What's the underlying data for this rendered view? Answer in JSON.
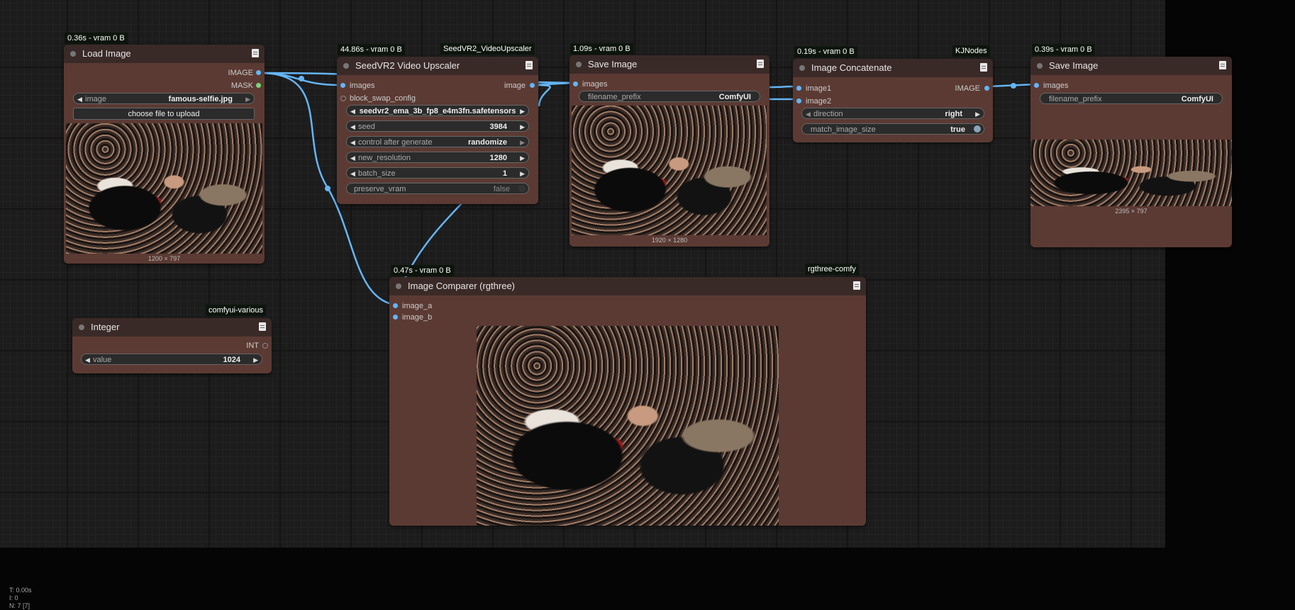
{
  "colors": {
    "canvas": "#1c1c1c",
    "node_body": "#5b3a33",
    "node_title": "#3a2a27",
    "link": "#64b5f6",
    "badge": "#0d150d"
  },
  "nodes": {
    "load_image": {
      "badge": "0.36s - vram 0 B",
      "title": "Load Image",
      "outputs": [
        "IMAGE",
        "MASK"
      ],
      "image_widget": {
        "label": "image",
        "value": "famous-selfie.jpg"
      },
      "upload_button": "choose file to upload",
      "size": "1200 × 797"
    },
    "seedvr2": {
      "badge": "44.86s - vram 0 B",
      "source": "SeedVR2_VideoUpscaler",
      "title": "SeedVR2 Video Upscaler",
      "inputs": [
        "images",
        "block_swap_config"
      ],
      "output": "image",
      "widgets": [
        {
          "label": "",
          "value": "seedvr2_ema_3b_fp8_e4m3fn.safetensors"
        },
        {
          "label": "seed",
          "value": "3984"
        },
        {
          "label": "control after generate",
          "value": "randomize"
        },
        {
          "label": "new_resolution",
          "value": "1280"
        },
        {
          "label": "batch_size",
          "value": "1"
        },
        {
          "label": "preserve_vram",
          "value": "false"
        }
      ]
    },
    "save_image_1": {
      "badge": "1.09s - vram 0 B",
      "title": "Save Image",
      "input": "images",
      "prefix_label": "filename_prefix",
      "prefix_value": "ComfyUI",
      "size": "1920 × 1280"
    },
    "concat": {
      "badge": "0.19s - vram 0 B",
      "source": "KJNodes",
      "title": "Image Concatenate",
      "inputs": [
        "image1",
        "image2"
      ],
      "output": "IMAGE",
      "widgets": [
        {
          "label": "direction",
          "value": "right"
        },
        {
          "label": "match_image_size",
          "value": "true"
        }
      ]
    },
    "save_image_2": {
      "badge": "0.39s - vram 0 B",
      "title": "Save Image",
      "input": "images",
      "prefix_label": "filename_prefix",
      "prefix_value": "ComfyUI",
      "size": "2395 × 797"
    },
    "comparer": {
      "badge": "0.47s - vram 0 B",
      "source": "rgthree-comfy",
      "title": "Image Comparer (rgthree)",
      "inputs": [
        "image_a",
        "image_b"
      ]
    },
    "integer": {
      "source": "comfyui-various",
      "title": "Integer",
      "output": "INT",
      "widget": {
        "label": "value",
        "value": "1024"
      }
    }
  },
  "stats": {
    "t": "T: 0.00s",
    "i": "I: 0",
    "n": "N: 7 [7]"
  }
}
